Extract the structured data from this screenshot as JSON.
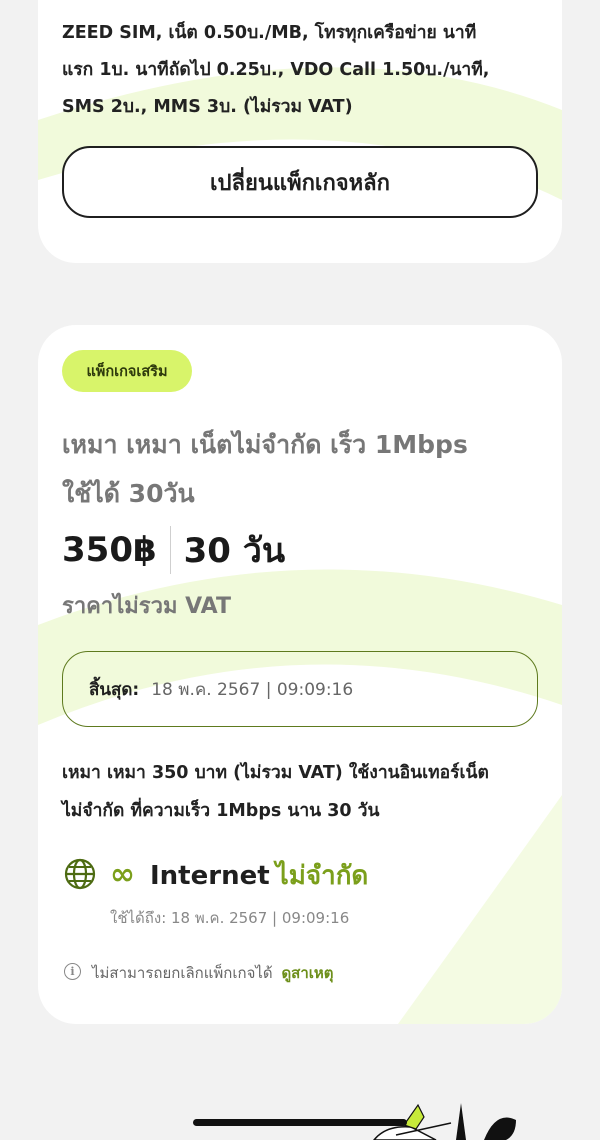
{
  "main_package": {
    "description": "ZEED SIM, เน็ต 0.50บ./MB, โทรทุกเครือข่าย นาที\nแรก 1บ. นาทีถัดไป 0.25บ., VDO Call 1.50บ./นาที,\nSMS 2บ., MMS 3บ. (ไม่รวม VAT)",
    "change_button_label": "เปลี่ยนแพ็กเกจหลัก"
  },
  "addon_package": {
    "badge": "แพ็กเกจเสริม",
    "title": "เหมา เหมา เน็ตไม่จำกัด เร็ว 1Mbps\nใช้ได้ 30วัน",
    "price": "350฿",
    "duration": "30 วัน",
    "vat_note": "ราคาไม่รวม VAT",
    "expiry_label": "สิ้นสุด:",
    "expiry_value": "18 พ.ค. 2567 | 09:09:16",
    "description": "เหมา เหมา 350 บาท (ไม่รวม VAT) ใช้งานอินเทอร์เน็ต\nไม่จำกัด ที่ความเร็ว 1Mbps นาน 30 วัน",
    "internet": {
      "icon": "globe-icon",
      "infinity_symbol": "∞",
      "label": "Internet",
      "value": "ไม่จำกัด",
      "usable_until": "ใช้ได้ถึง: 18 พ.ค. 2567 | 09:09:16"
    },
    "cancel_note": "ไม่สามารถยกเลิกแพ็กเกจได้",
    "see_reason_link": "ดูสาเหตุ"
  },
  "colors": {
    "accent_lime": "#d8f46a",
    "accent_green": "#7b9f1b",
    "border_green": "#5e7a1e",
    "background": "#f2f2f2"
  }
}
